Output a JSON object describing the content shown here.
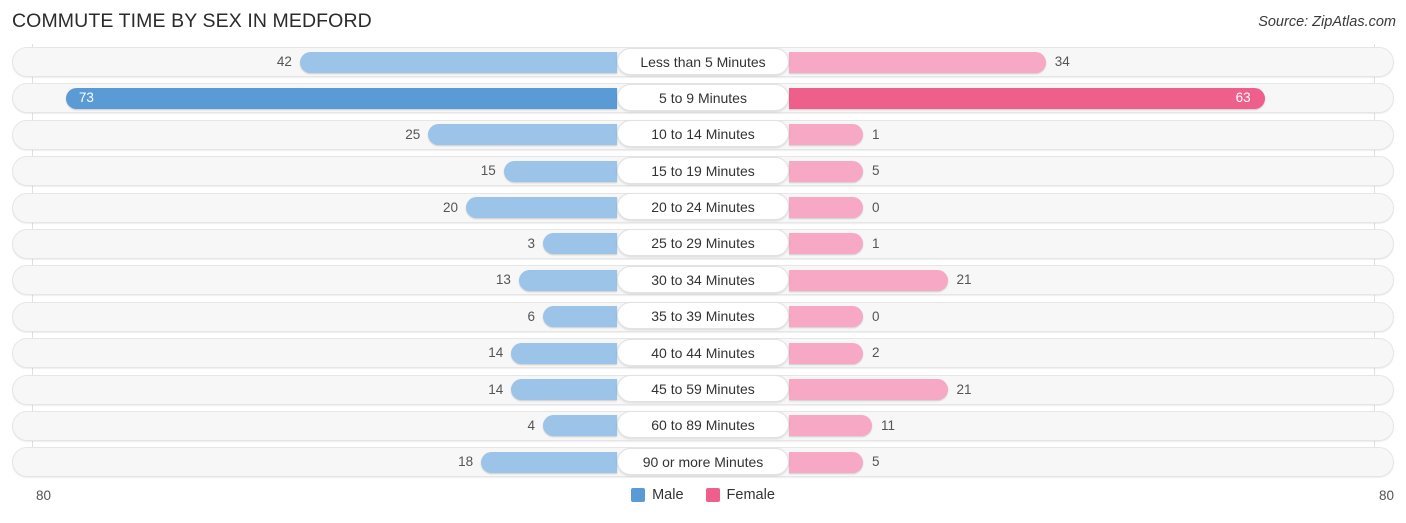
{
  "header": {
    "title": "COMMUTE TIME BY SEX IN MEDFORD",
    "source": "Source: ZipAtlas.com"
  },
  "axis": {
    "left_label": "80",
    "right_label": "80"
  },
  "legend": {
    "items": [
      {
        "label": "Male",
        "color": "#5b9bd5"
      },
      {
        "label": "Female",
        "color": "#ef5f8b"
      }
    ]
  },
  "colors": {
    "male_max": "#5b9bd5",
    "male_normal": "#9cc3e8",
    "female_max": "#ef5f8b",
    "female_normal": "#f7a8c4",
    "track_bg": "#f7f7f7",
    "track_border": "#e6e6e6",
    "gridline": "#e0e0e0"
  },
  "chart_data": {
    "type": "bar",
    "orientation": "horizontal-diverging",
    "title": "COMMUTE TIME BY SEX IN MEDFORD",
    "xlabel": "",
    "ylabel": "",
    "xlim": [
      80,
      80
    ],
    "grid": true,
    "legend_position": "bottom-center",
    "categories": [
      "Less than 5 Minutes",
      "5 to 9 Minutes",
      "10 to 14 Minutes",
      "15 to 19 Minutes",
      "20 to 24 Minutes",
      "25 to 29 Minutes",
      "30 to 34 Minutes",
      "35 to 39 Minutes",
      "40 to 44 Minutes",
      "45 to 59 Minutes",
      "60 to 89 Minutes",
      "90 or more Minutes"
    ],
    "series": [
      {
        "name": "Male",
        "values": [
          42,
          73,
          25,
          15,
          20,
          3,
          13,
          6,
          14,
          14,
          4,
          18
        ]
      },
      {
        "name": "Female",
        "values": [
          34,
          63,
          1,
          5,
          0,
          1,
          21,
          0,
          2,
          21,
          11,
          5
        ]
      }
    ]
  }
}
